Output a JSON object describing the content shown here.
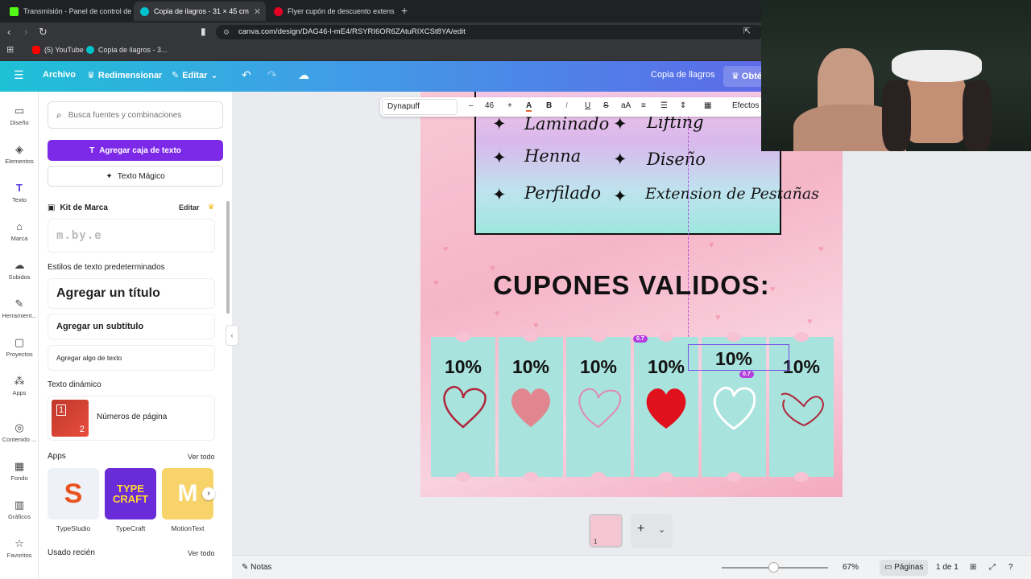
{
  "browser": {
    "tabs": [
      {
        "title": "Transmisión - Panel de control de Ki",
        "color": "#53fc18"
      },
      {
        "title": "Copia de ilagros - 31 × 45 cm",
        "color": "#00c4cc"
      },
      {
        "title": "Flyer cupón de descuento extensión",
        "color": "#e60023"
      }
    ],
    "url": "canva.com/design/DAG46-l-mE4/RSYRI6OR6ZAtuRIXCSt8YA/edit",
    "bookmarks": [
      "(5) YouTube",
      "Copia de ilagros - 3..."
    ]
  },
  "canva_bar": {
    "archivo": "Archivo",
    "redimensionar": "Redimensionar",
    "editar": "Editar",
    "doc_title": "Copia de llagros",
    "upgrade": "Obtén"
  },
  "rail": [
    {
      "label": "Diseño",
      "icon": "layout-icon"
    },
    {
      "label": "Elementos",
      "icon": "shapes-icon"
    },
    {
      "label": "Texto",
      "icon": "text-icon"
    },
    {
      "label": "Marca",
      "icon": "brand-icon"
    },
    {
      "label": "Subidos",
      "icon": "upload-icon"
    },
    {
      "label": "Herramient...",
      "icon": "draw-icon"
    },
    {
      "label": "Proyectos",
      "icon": "folder-icon"
    },
    {
      "label": "Apps",
      "icon": "apps-icon"
    },
    {
      "label": "Contenido ...",
      "icon": "content-icon"
    },
    {
      "label": "Fondo",
      "icon": "background-icon"
    },
    {
      "label": "Gráficos",
      "icon": "chart-icon"
    },
    {
      "label": "Favoritos",
      "icon": "star-icon"
    }
  ],
  "panel": {
    "search_placeholder": "Busca fuentes y combinaciones",
    "add_text_box": "Agregar caja de texto",
    "magic_text": "Texto Mágico",
    "brand_kit": "Kit de Marca",
    "brand_edit": "Editar",
    "brand_logo": "m.by.e",
    "default_styles": "Estilos de texto predeterminados",
    "add_title": "Agregar un título",
    "add_subtitle": "Agregar un subtítulo",
    "add_body": "Agregar algo de texto",
    "dynamic_text": "Texto dinámico",
    "page_numbers": "Números de página",
    "apps": "Apps",
    "see_all": "Ver todo",
    "app_list": [
      "TypeStudio",
      "TypeCraft",
      "MotionText"
    ],
    "recent": "Usado recién",
    "recent_see_all": "Ver todo"
  },
  "text_toolbar": {
    "font": "Dynapuff",
    "size": "46",
    "effects": "Efectos"
  },
  "design": {
    "services": [
      "Laminado",
      "Lifting",
      "Henna",
      "Diseño",
      "Perfilado",
      "Extension de Pestañas"
    ],
    "title": "CUPONES VALIDOS:",
    "coupons": [
      {
        "pct": "10%",
        "heart": "outline",
        "color": "#b0263b"
      },
      {
        "pct": "10%",
        "heart": "blurred",
        "color": "#e77b86"
      },
      {
        "pct": "10%",
        "heart": "outline",
        "color": "#e08ab0"
      },
      {
        "pct": "10%",
        "heart": "filled",
        "color": "#e0101c"
      },
      {
        "pct": "10%",
        "heart": "outline",
        "color": "#ffffff"
      },
      {
        "pct": "10%",
        "heart": "outline",
        "color": "#b0263b"
      }
    ],
    "selected_text": "10%",
    "guide_badge_1": "0.7",
    "guide_badge_2": "0.7"
  },
  "bottom": {
    "notes": "Notas",
    "zoom": "67%",
    "pages": "Páginas",
    "page_count": "1 de 1",
    "thumb_number": "1"
  }
}
